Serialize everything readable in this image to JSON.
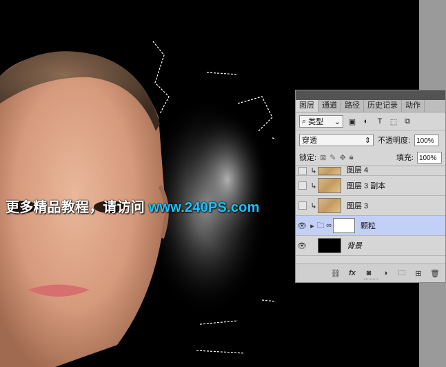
{
  "watermark": {
    "part1": "更多精品教程，请访问 ",
    "part2": "www.240PS.com"
  },
  "panel": {
    "tabs": [
      "图层",
      "通道",
      "路径",
      "历史记录",
      "动作"
    ],
    "filter_label": "类型",
    "filter_icons": [
      "image-icon",
      "adjustment-icon",
      "type-icon",
      "shape-icon",
      "smart-object-icon"
    ],
    "blend_mode": "穿透",
    "opacity_label": "不透明度:",
    "opacity_value": "100%",
    "lock_label": "锁定:",
    "fill_label": "填充:",
    "fill_value": "100%",
    "layers": [
      {
        "name": "图层 4",
        "visible": false,
        "clipped": true
      },
      {
        "name": "图层 3 副本",
        "visible": false,
        "clipped": true
      },
      {
        "name": "图层 3",
        "visible": false,
        "clipped": true
      },
      {
        "name": "颗粒",
        "visible": true,
        "group": true,
        "selected": true
      },
      {
        "name": "背景",
        "visible": true,
        "italic": true
      }
    ]
  },
  "colors": {
    "canvas_bg": "#000000",
    "panel_bg": "#d6d6d6",
    "selected_row": "#c3d0f5",
    "watermark_accent": "#19c3ff"
  }
}
